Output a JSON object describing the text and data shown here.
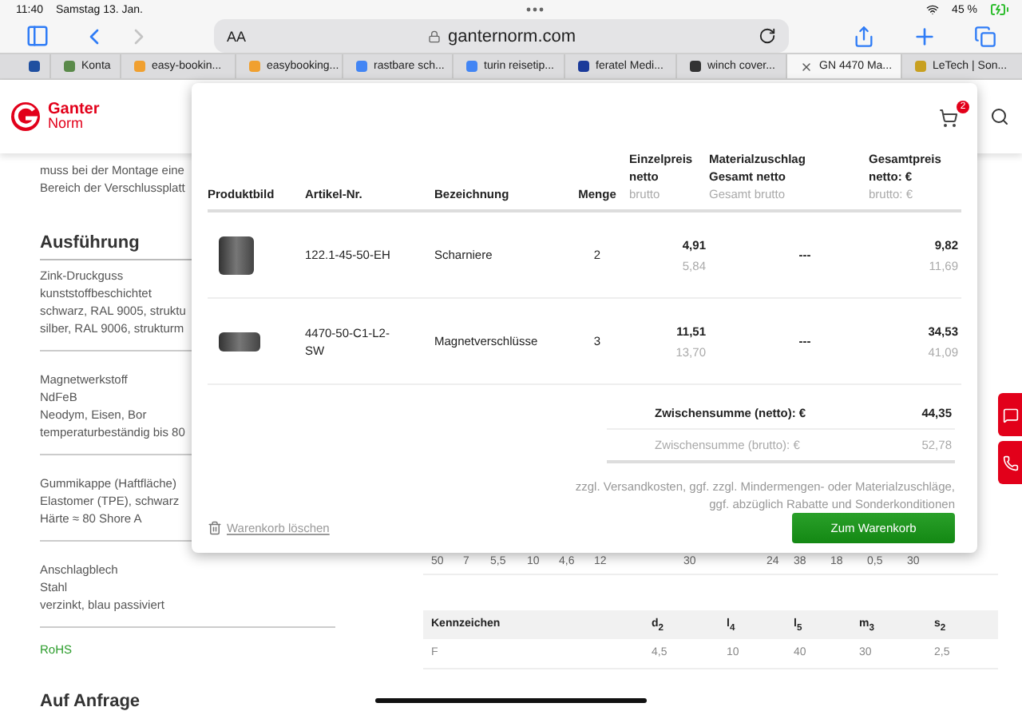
{
  "status_bar": {
    "time": "11:40",
    "date": "Samstag 13. Jan.",
    "battery": "45 %"
  },
  "toolbar": {
    "text_size": "AA",
    "url": "ganternorm.com",
    "forward_disabled": true
  },
  "tabs": [
    {
      "label": "Konta",
      "selected": false,
      "color": "#5a8a4a"
    },
    {
      "label": "easy-bookin...",
      "selected": false,
      "color": "#f0a030"
    },
    {
      "label": "easybooking...",
      "selected": false,
      "color": "#f0a030"
    },
    {
      "label": "rastbare sch...",
      "selected": false,
      "color": "#4285f4"
    },
    {
      "label": "turin reisetip...",
      "selected": false,
      "color": "#4285f4"
    },
    {
      "label": "feratel Medi...",
      "selected": false,
      "color": "#1a3a9a"
    },
    {
      "label": "winch cover...",
      "selected": false,
      "color": "#333333"
    },
    {
      "label": "GN 4470 Ma...",
      "selected": true
    },
    {
      "label": "LeTech | Son...",
      "selected": false,
      "color": "#c8a020"
    }
  ],
  "header": {
    "brand": "Ganter",
    "brand_sub": "Norm"
  },
  "details": {
    "intro": [
      "muss bei der Montage eine",
      "Bereich der Verschlussplatt"
    ],
    "heading": "Ausführung",
    "groups": [
      [
        "Zink-Druckguss",
        "kunststoffbeschichtet",
        "schwarz, RAL 9005, struktu",
        "silber, RAL 9006, strukturm"
      ],
      [
        "Magnetwerkstoff",
        "NdFeB",
        "Neodym, Eisen, Bor",
        "temperaturbeständig bis 80"
      ],
      [
        "Gummikappe (Haftfläche)",
        "Elastomer (TPE), schwarz",
        "Härte ≈ 80 Shore A"
      ],
      [
        "Anschlagblech",
        "Stahl",
        "verzinkt, blau passiviert"
      ]
    ],
    "rohs": "RoHS",
    "next_heading": "Auf Anfrage"
  },
  "dimension_row": [
    "50",
    "7",
    "5,5",
    "10",
    "4,6",
    "12",
    "30",
    "24",
    "38",
    "18",
    "0,5",
    "30"
  ],
  "marking_table": {
    "columns": [
      "Kennzeichen",
      "d$_{2}$",
      "l$_{4}$",
      "l$_{5}$",
      "m$_{3}$",
      "s$_{2}$"
    ],
    "rows": [
      [
        "F",
        "4,5",
        "10",
        "40",
        "30",
        "2,5"
      ]
    ]
  },
  "cart": {
    "badge": "2",
    "columns": [
      {
        "title": [
          "Produktbild"
        ]
      },
      {
        "title": [
          "Artikel-Nr."
        ]
      },
      {
        "title": [
          "Bezeichnung"
        ]
      },
      {
        "title": [
          "Menge"
        ]
      },
      {
        "title": [
          "Einzelpreis",
          "netto"
        ],
        "subtitle": "brutto"
      },
      {
        "title": [
          "Materialzuschlag",
          "Gesamt netto"
        ],
        "subtitle": "Gesamt brutto"
      },
      {
        "title": [
          "Gesamtpreis",
          "netto: €"
        ],
        "subtitle": "brutto: €"
      }
    ],
    "items": [
      {
        "article": "122.1-45-50-EH",
        "name": "Scharniere",
        "quantity": "2",
        "unit_net": "4,91",
        "unit_gross": "5,84",
        "surcharge": "---",
        "total_net": "9,82",
        "total_gross": "11,69"
      },
      {
        "article": "4470-50-C1-L2-SW",
        "name": "Magnetverschlüsse",
        "quantity": "3",
        "unit_net": "11,51",
        "unit_gross": "13,70",
        "surcharge": "---",
        "total_net": "34,53",
        "total_gross": "41,09"
      }
    ],
    "subtotal_net_label": "Zwischensumme (netto): €",
    "subtotal_net": "44,35",
    "subtotal_gross_label": "Zwischensumme (brutto): €",
    "subtotal_gross": "52,78",
    "note": [
      "zzgl. Versandkosten, ggf. zzgl. Mindermengen- oder Materialzuschläge,",
      "ggf. abzüglich Rabatte und Sonderkonditionen"
    ],
    "clear_link": "Warenkorb löschen",
    "checkout_button": "Zum Warenkorb"
  }
}
